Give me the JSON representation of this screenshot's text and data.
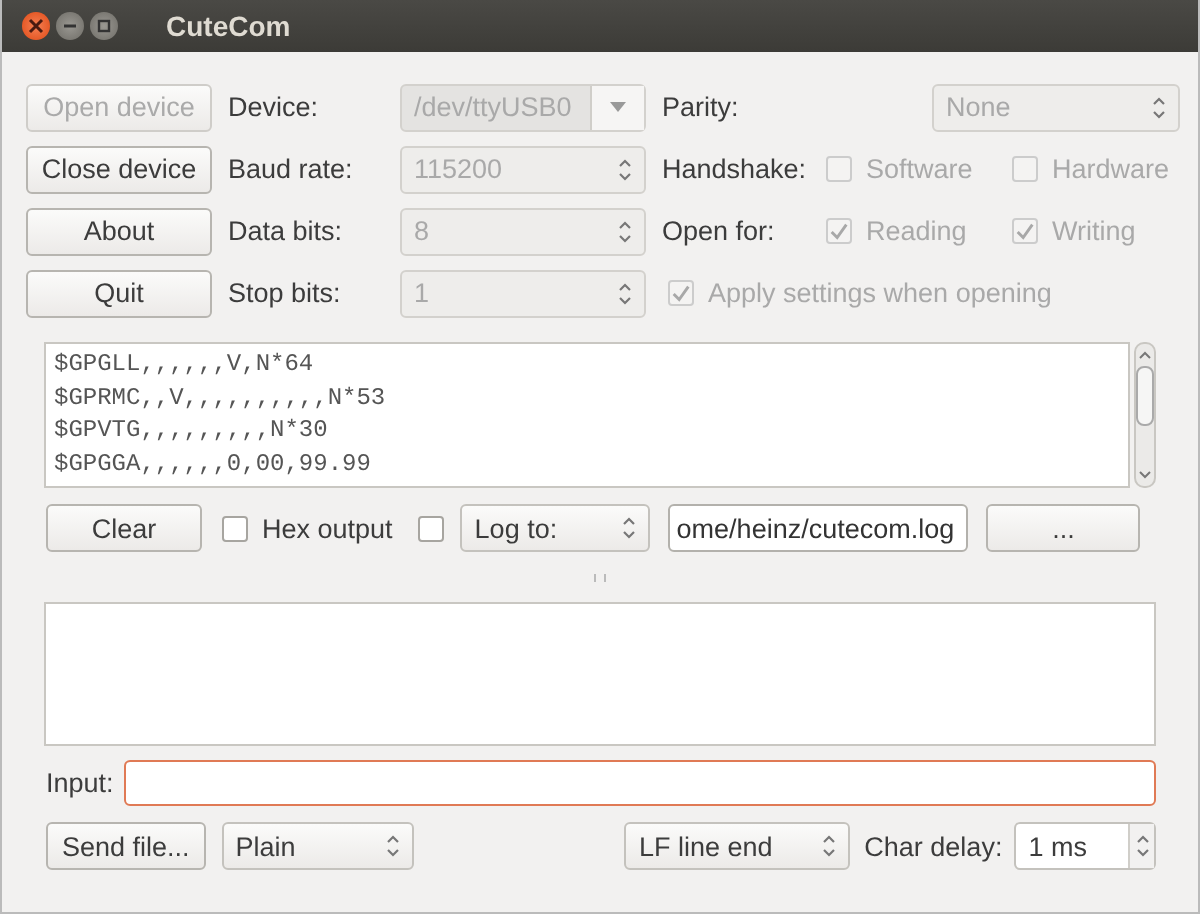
{
  "window": {
    "title": "CuteCom"
  },
  "device_buttons": [
    {
      "label": "Open device",
      "disabled": true
    },
    {
      "label": "Close device",
      "disabled": false
    },
    {
      "label": "About",
      "disabled": false
    },
    {
      "label": "Quit",
      "disabled": false
    }
  ],
  "settings": [
    {
      "label": "Device:",
      "value": "/dev/ttyUSB0",
      "kind": "dropdown",
      "disabled": true
    },
    {
      "label": "Baud rate:",
      "value": "115200",
      "kind": "spin",
      "disabled": true
    },
    {
      "label": "Data bits:",
      "value": "8",
      "kind": "spin",
      "disabled": true
    },
    {
      "label": "Stop bits:",
      "value": "1",
      "kind": "spin",
      "disabled": true
    }
  ],
  "parity": {
    "label": "Parity:",
    "value": "None",
    "disabled": true
  },
  "handshake": {
    "label": "Handshake:",
    "options": [
      {
        "label": "Software",
        "checked": false,
        "disabled": true
      },
      {
        "label": "Hardware",
        "checked": false,
        "disabled": true
      }
    ]
  },
  "open_for": {
    "label": "Open for:",
    "options": [
      {
        "label": "Reading",
        "checked": true,
        "disabled": true
      },
      {
        "label": "Writing",
        "checked": true,
        "disabled": true
      }
    ]
  },
  "apply_settings": {
    "label": "Apply settings when opening",
    "checked": true,
    "disabled": true
  },
  "output_lines": [
    "$GPGLL,,,,,,V,N*64",
    "$GPRMC,,V,,,,,,,,,,N*53",
    "$GPVTG,,,,,,,,,N*30",
    "$GPGGA,,,,,,0,00,99.99"
  ],
  "output_controls": {
    "clear": "Clear",
    "hex_output": {
      "label": "Hex output",
      "checked": false
    },
    "log_enabled": {
      "checked": false
    },
    "log_mode": "Log to:",
    "log_file": "ome/heinz/cutecom.log",
    "browse": "..."
  },
  "input": {
    "label": "Input:"
  },
  "send_controls": {
    "send_file": "Send file...",
    "format": "Plain",
    "line_end": "LF line end",
    "char_delay_label": "Char delay:",
    "char_delay": "1 ms"
  }
}
